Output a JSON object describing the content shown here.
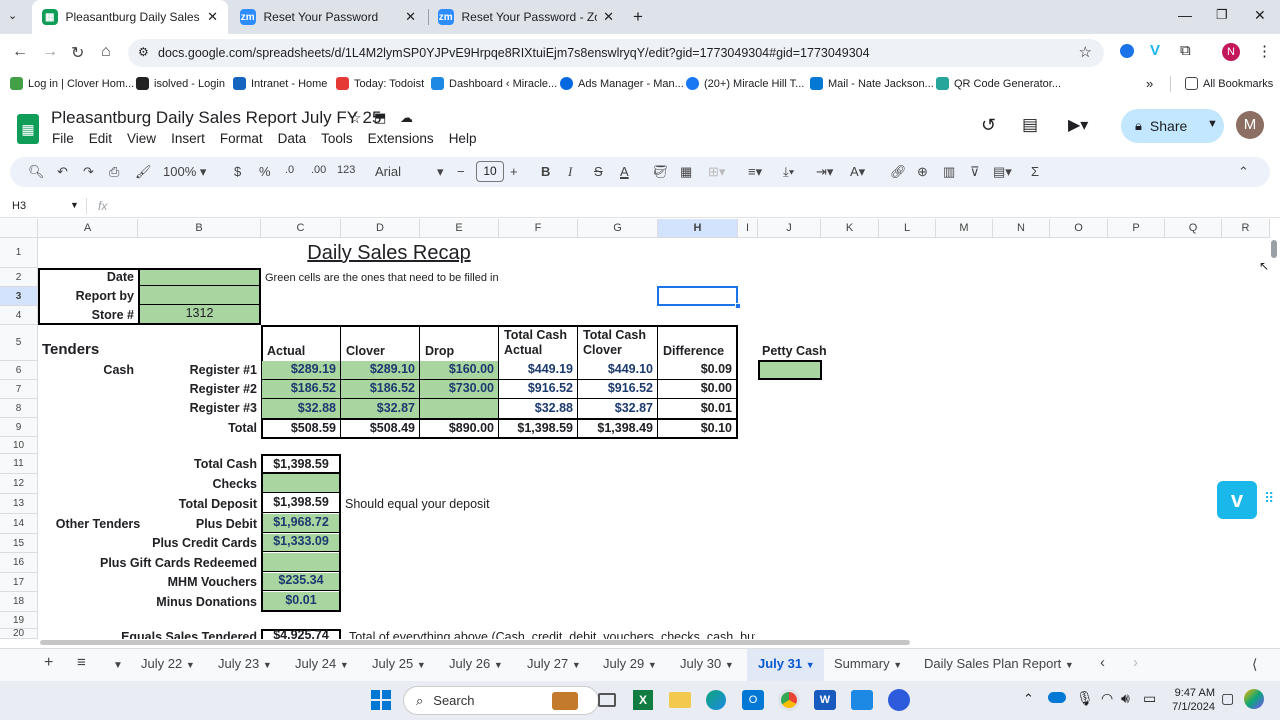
{
  "browser": {
    "tabs": [
      {
        "title": "Pleasantburg Daily Sales Report",
        "icon": "sheets-icon",
        "active": true
      },
      {
        "title": "Reset Your Password",
        "icon": "zoom-icon",
        "active": false
      },
      {
        "title": "Reset Your Password - Zoom",
        "icon": "zoom-icon",
        "active": false
      }
    ],
    "url": "docs.google.com/spreadsheets/d/1L4M2lymSP0YJPvE9Hrpqe8RIXtuiEjm7s8enswlryqY/edit?gid=1773049304#gid=1773049304",
    "bookmarks": [
      "Log in | Clover Hom...",
      "isolved - Login",
      "Intranet - Home",
      "Today: Todoist",
      "Dashboard ‹ Miracle...",
      "Ads Manager - Man...",
      "(20+) Miracle Hill T...",
      "Mail - Nate Jackson...",
      "QR Code Generator..."
    ],
    "all_bookmarks": "All Bookmarks",
    "profile_initial": "N"
  },
  "doc": {
    "title": "Pleasantburg Daily Sales Report July FY 25",
    "menu": [
      "File",
      "Edit",
      "View",
      "Insert",
      "Format",
      "Data",
      "Tools",
      "Extensions",
      "Help"
    ],
    "share": "Share",
    "avatar": "M"
  },
  "toolbar": {
    "zoom": "100%",
    "currency": "$",
    "percent": "%",
    "dec_less": ".0",
    "dec_more": ".00",
    "number_format": "123",
    "font": "Arial",
    "font_size": "10",
    "bold": "B",
    "italic": "I",
    "strike": "S",
    "text_color": "A"
  },
  "formula_bar": {
    "cell_ref": "H3",
    "fx": "fx"
  },
  "columns": [
    "A",
    "B",
    "C",
    "D",
    "E",
    "F",
    "G",
    "H",
    "I",
    "J",
    "K",
    "L",
    "M",
    "N",
    "O",
    "P",
    "Q",
    "R"
  ],
  "rows": [
    "1",
    "2",
    "3",
    "4",
    "5",
    "6",
    "7",
    "8",
    "9",
    "10",
    "11",
    "12",
    "13",
    "14",
    "15",
    "16",
    "17",
    "18",
    "19",
    "20"
  ],
  "sheet": {
    "title": "Daily Sales Recap",
    "date_label": "Date",
    "report_by_label": "Report by",
    "store_label": "Store #",
    "store_value": "1312",
    "note_green": "Green cells are the ones that need to be filled in",
    "tenders": "Tenders",
    "cash": "Cash",
    "hdr_actual": "Actual",
    "hdr_clover": "Clover",
    "hdr_drop": "Drop",
    "hdr_tca1": "Total Cash",
    "hdr_tca2": "Actual",
    "hdr_tcc1": "Total Cash",
    "hdr_tcc2": "Clover",
    "hdr_diff": "Difference",
    "petty_cash": "Petty Cash",
    "registers": [
      {
        "label": "Register #1",
        "actual": "$289.19",
        "clover": "$289.10",
        "drop": "$160.00",
        "tca": "$449.19",
        "tcc": "$449.10",
        "diff": "$0.09"
      },
      {
        "label": "Register #2",
        "actual": "$186.52",
        "clover": "$186.52",
        "drop": "$730.00",
        "tca": "$916.52",
        "tcc": "$916.52",
        "diff": "$0.00"
      },
      {
        "label": "Register #3",
        "actual": "$32.88",
        "clover": "$32.87",
        "drop": "",
        "tca": "$32.88",
        "tcc": "$32.87",
        "diff": "$0.01"
      }
    ],
    "total": {
      "label": "Total",
      "actual": "$508.59",
      "clover": "$508.49",
      "drop": "$890.00",
      "tca": "$1,398.59",
      "tcc": "$1,398.49",
      "diff": "$0.10"
    },
    "total_cash_label": "Total Cash",
    "total_cash": "$1,398.59",
    "checks_label": "Checks",
    "total_deposit_label": "Total Deposit",
    "total_deposit": "$1,398.59",
    "deposit_note": "Should equal your deposit",
    "other_tenders": "Other Tenders",
    "plus_debit_label": "Plus Debit",
    "plus_debit": "$1,968.72",
    "credit_label": "Plus Credit Cards",
    "credit": "$1,333.09",
    "gift_label": "Plus Gift Cards Redeemed",
    "mhm_label": "MHM Vouchers",
    "mhm": "$235.34",
    "donations_label": "Minus Donations",
    "donations": "$0.01",
    "equals_label": "Equals Sales Tendered",
    "equals": "$4,925.74",
    "equals_note": "Total of everything above (Cash, credit, debit, vouchers, checks, cash, but"
  },
  "sheet_tabs": [
    "July 22",
    "July 23",
    "July 24",
    "July 25",
    "July 26",
    "July 27",
    "July 29",
    "July 30",
    "July 31",
    "Summary",
    "Daily Sales Plan Report"
  ],
  "active_sheet": "July 31",
  "taskbar": {
    "search": "Search",
    "time": "9:47 AM",
    "date": "7/1/2024"
  }
}
